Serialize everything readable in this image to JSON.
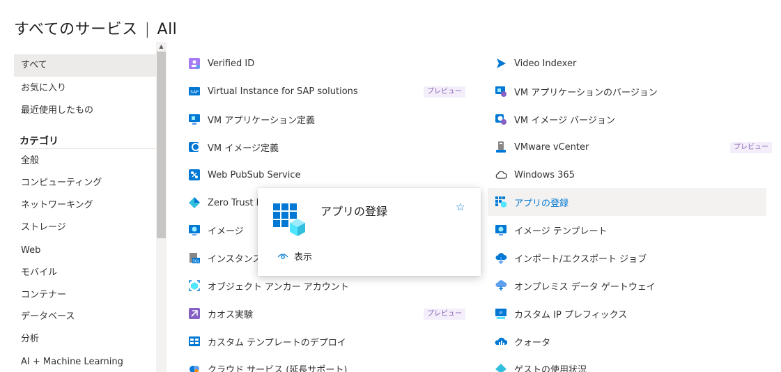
{
  "header": {
    "title": "すべてのサービス",
    "separator": "|",
    "subtitle": "All"
  },
  "sidebar": {
    "top_items": [
      "すべて",
      "お気に入り",
      "最近使用したもの"
    ],
    "category_heading": "カテゴリ",
    "categories": [
      "全般",
      "コンピューティング",
      "ネットワーキング",
      "ストレージ",
      "Web",
      "モバイル",
      "コンテナー",
      "データベース",
      "分析",
      "AI + Machine Learning"
    ]
  },
  "services_left": [
    {
      "label": "Verified ID",
      "icon": "verified-id-icon"
    },
    {
      "label": "Virtual Instance for SAP solutions",
      "icon": "sap-icon",
      "badge": "プレビュー"
    },
    {
      "label": "VM アプリケーション定義",
      "icon": "vm-app-definition-icon"
    },
    {
      "label": "VM イメージ定義",
      "icon": "vm-image-definition-icon"
    },
    {
      "label": "Web PubSub Service",
      "icon": "web-pubsub-icon"
    },
    {
      "label": "Zero Trust Ne",
      "icon": "zero-trust-icon"
    },
    {
      "label": "イメージ",
      "icon": "image-icon"
    },
    {
      "label": "インスタンス プ",
      "icon": "sql-instance-icon"
    },
    {
      "label": "オブジェクト アンカー アカウント",
      "icon": "object-anchors-icon"
    },
    {
      "label": "カオス実験",
      "icon": "chaos-experiment-icon",
      "badge": "プレビュー"
    },
    {
      "label": "カスタム テンプレートのデプロイ",
      "icon": "template-deploy-icon"
    },
    {
      "label": "クラウド サービス (延長サポート)",
      "icon": "cloud-services-icon"
    }
  ],
  "services_right": [
    {
      "label": "Video Indexer",
      "icon": "video-indexer-icon"
    },
    {
      "label": "VM アプリケーションのバージョン",
      "icon": "vm-app-version-icon"
    },
    {
      "label": "VM イメージ バージョン",
      "icon": "vm-image-version-icon"
    },
    {
      "label": "VMware vCenter",
      "icon": "vmware-vcenter-icon",
      "badge": "プレビュー"
    },
    {
      "label": "Windows 365",
      "icon": "cloud-outline-icon"
    },
    {
      "label": "アプリの登録",
      "icon": "app-registration-icon",
      "highlighted": true
    },
    {
      "label": "イメージ テンプレート",
      "icon": "image-template-icon"
    },
    {
      "label": "インポート/エクスポート ジョブ",
      "icon": "import-export-icon"
    },
    {
      "label": "オンプレミス データ ゲートウェイ",
      "icon": "data-gateway-icon"
    },
    {
      "label": "カスタム IP プレフィックス",
      "icon": "custom-ip-icon"
    },
    {
      "label": "クォータ",
      "icon": "quota-icon"
    },
    {
      "label": "ゲストの使用状況",
      "icon": "guest-usage-icon"
    }
  ],
  "popup": {
    "title": "アプリの登録",
    "view_label": "表示",
    "icon": "app-registration-icon",
    "star_icon": "star-outline-icon"
  },
  "colors": {
    "accent": "#0078d4",
    "preview_badge": "#8764b8",
    "selected_bg": "#edebe9"
  }
}
